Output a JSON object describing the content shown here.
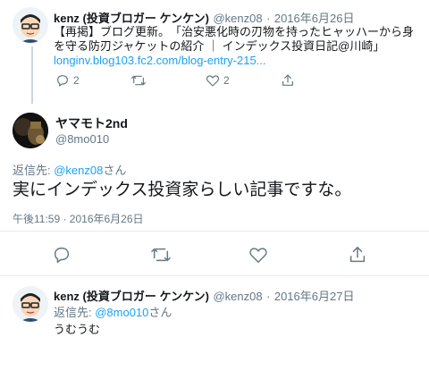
{
  "tweet1": {
    "name": "kenz (投資ブロガー ケンケン)",
    "handle": "@kenz08",
    "sep": "·",
    "date": "2016年6月26日",
    "line1": "【再掲】ブログ更新。　「治安悪化時の刃物を持ったヒャッハーから身",
    "line2": "を守る防刃ジャケットの紹介 ｜ インデックス投資日記@川崎」",
    "link": "longinv.blog103.fc2.com/blog-entry-215...",
    "reply_count": "2",
    "like_count": "2"
  },
  "tweet2": {
    "name": "ヤマモト2nd",
    "handle": "@8mo010",
    "reply_prefix": "返信先: ",
    "reply_to": "@kenz08",
    "reply_suffix": "さん",
    "text": "実にインデックス投資家らしい記事ですな。",
    "timestamp": "午後11:59 · 2016年6月26日"
  },
  "tweet3": {
    "name": "kenz (投資ブロガー ケンケン)",
    "handle": "@kenz08",
    "sep": "·",
    "date": "2016年6月27日",
    "reply_prefix": "返信先: ",
    "reply_to": "@8mo010",
    "reply_suffix": "さん",
    "text": "うむうむ"
  },
  "icons": [
    "reply-icon",
    "retweet-icon",
    "like-icon",
    "share-icon"
  ],
  "colors": {
    "link": "#1da1f2",
    "muted": "#657786",
    "text": "#14171a",
    "divider": "#e6ecf0"
  }
}
